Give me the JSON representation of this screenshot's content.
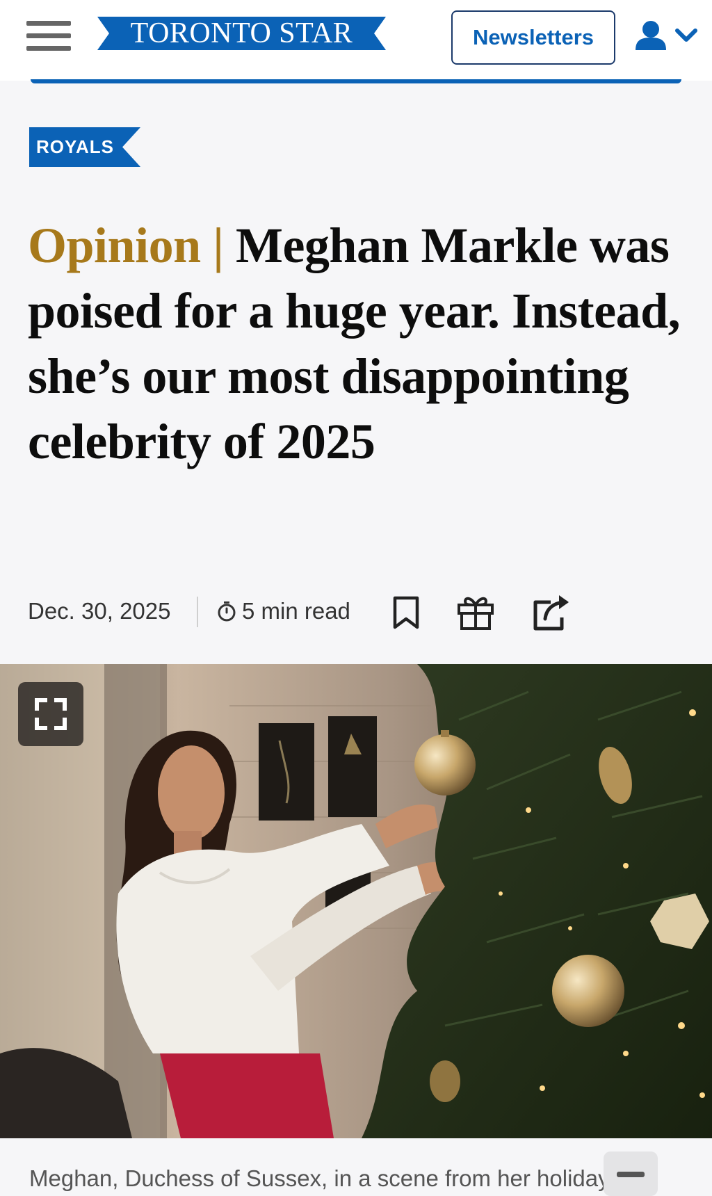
{
  "header": {
    "logo_text": "TORONTO STAR",
    "newsletters_label": "Newsletters",
    "menu_icon": "hamburger-menu-icon",
    "account_icon": "user-icon",
    "account_dropdown_icon": "chevron-down-icon"
  },
  "section_tag": "ROYALS",
  "headline": {
    "kicker": "Opinion",
    "separator": "|",
    "title": "Meghan Markle was poised for a huge year. Instead, she’s our most disappointing celebrity of 2025"
  },
  "meta": {
    "date": "Dec. 30, 2025",
    "read_time": "5 min read",
    "timer_icon": "stopwatch-icon",
    "bookmark_icon": "bookmark-icon",
    "gift_icon": "gift-icon",
    "share_icon": "share-icon"
  },
  "hero": {
    "expand_icon": "fullscreen-expand-icon"
  },
  "caption": {
    "text": "Meghan, Duchess of Sussex, in a scene from her holiday",
    "collapse_icon": "minus-icon"
  },
  "colors": {
    "brand_blue": "#0b62b6",
    "opinion_gold": "#a7791b",
    "header_border": "#1b3a6b"
  }
}
